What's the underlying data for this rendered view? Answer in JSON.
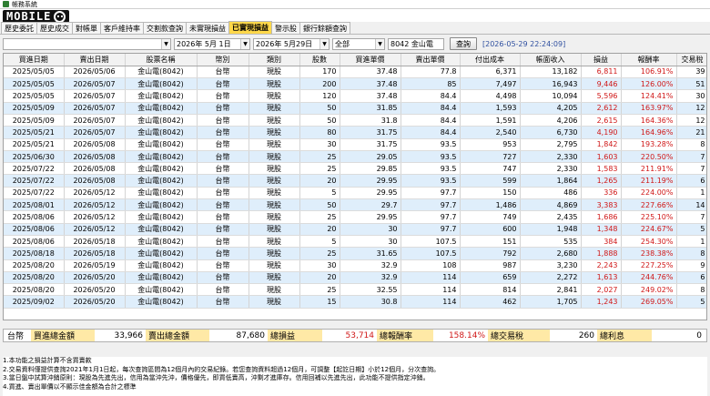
{
  "window": {
    "title": "帳務系統"
  },
  "logo": {
    "text": "MOBILE"
  },
  "tabs": [
    {
      "label": "歷史委託",
      "active": false
    },
    {
      "label": "歷史成交",
      "active": false
    },
    {
      "label": "對帳單",
      "active": false
    },
    {
      "label": "客戶維持率",
      "active": false
    },
    {
      "label": "交割款查詢",
      "active": false
    },
    {
      "label": "未實現損益",
      "active": false
    },
    {
      "label": "已實現損益",
      "active": true
    },
    {
      "label": "警示股",
      "active": false
    },
    {
      "label": "銀行餘額查詢",
      "active": false
    }
  ],
  "toolbar": {
    "account_value": "",
    "start_date": "2026年 5月 1日",
    "end_date": "2026年 5月29日",
    "market_filter": "全部",
    "stock_filter": "8042 金山電",
    "query_label": "查詢",
    "timestamp": "[2026-05-29 22:24:09]"
  },
  "table": {
    "columns": [
      "買進日期",
      "賣出日期",
      "股票名稱",
      "幣別",
      "類別",
      "股數",
      "買進單價",
      "賣出單價",
      "付出成本",
      "帳面收入",
      "損益",
      "報酬率",
      "交易稅"
    ],
    "rows": [
      [
        "2025/05/05",
        "2026/05/06",
        "金山電(8042)",
        "台幣",
        "現股",
        "170",
        "37.48",
        "77.8",
        "6,371",
        "13,182",
        "6,811",
        "106.91%",
        "39"
      ],
      [
        "2025/05/05",
        "2026/05/07",
        "金山電(8042)",
        "台幣",
        "現股",
        "200",
        "37.48",
        "85",
        "7,497",
        "16,943",
        "9,446",
        "126.00%",
        "51"
      ],
      [
        "2025/05/05",
        "2026/05/07",
        "金山電(8042)",
        "台幣",
        "現股",
        "120",
        "37.48",
        "84.4",
        "4,498",
        "10,094",
        "5,596",
        "124.41%",
        "30"
      ],
      [
        "2025/05/09",
        "2026/05/07",
        "金山電(8042)",
        "台幣",
        "現股",
        "50",
        "31.85",
        "84.4",
        "1,593",
        "4,205",
        "2,612",
        "163.97%",
        "12"
      ],
      [
        "2025/05/09",
        "2026/05/07",
        "金山電(8042)",
        "台幣",
        "現股",
        "50",
        "31.8",
        "84.4",
        "1,591",
        "4,206",
        "2,615",
        "164.36%",
        "12"
      ],
      [
        "2025/05/21",
        "2026/05/07",
        "金山電(8042)",
        "台幣",
        "現股",
        "80",
        "31.75",
        "84.4",
        "2,540",
        "6,730",
        "4,190",
        "164.96%",
        "21"
      ],
      [
        "2025/05/21",
        "2026/05/08",
        "金山電(8042)",
        "台幣",
        "現股",
        "30",
        "31.75",
        "93.5",
        "953",
        "2,795",
        "1,842",
        "193.28%",
        "8"
      ],
      [
        "2025/06/30",
        "2026/05/08",
        "金山電(8042)",
        "台幣",
        "現股",
        "25",
        "29.05",
        "93.5",
        "727",
        "2,330",
        "1,603",
        "220.50%",
        "7"
      ],
      [
        "2025/07/22",
        "2026/05/08",
        "金山電(8042)",
        "台幣",
        "現股",
        "25",
        "29.85",
        "93.5",
        "747",
        "2,330",
        "1,583",
        "211.91%",
        "7"
      ],
      [
        "2025/07/22",
        "2026/05/08",
        "金山電(8042)",
        "台幣",
        "現股",
        "20",
        "29.95",
        "93.5",
        "599",
        "1,864",
        "1,265",
        "211.19%",
        "6"
      ],
      [
        "2025/07/22",
        "2026/05/12",
        "金山電(8042)",
        "台幣",
        "現股",
        "5",
        "29.95",
        "97.7",
        "150",
        "486",
        "336",
        "224.00%",
        "1"
      ],
      [
        "2025/08/01",
        "2026/05/12",
        "金山電(8042)",
        "台幣",
        "現股",
        "50",
        "29.7",
        "97.7",
        "1,486",
        "4,869",
        "3,383",
        "227.66%",
        "14"
      ],
      [
        "2025/08/06",
        "2026/05/12",
        "金山電(8042)",
        "台幣",
        "現股",
        "25",
        "29.95",
        "97.7",
        "749",
        "2,435",
        "1,686",
        "225.10%",
        "7"
      ],
      [
        "2025/08/06",
        "2026/05/12",
        "金山電(8042)",
        "台幣",
        "現股",
        "20",
        "30",
        "97.7",
        "600",
        "1,948",
        "1,348",
        "224.67%",
        "5"
      ],
      [
        "2025/08/06",
        "2026/05/18",
        "金山電(8042)",
        "台幣",
        "現股",
        "5",
        "30",
        "107.5",
        "151",
        "535",
        "384",
        "254.30%",
        "1"
      ],
      [
        "2025/08/18",
        "2026/05/18",
        "金山電(8042)",
        "台幣",
        "現股",
        "25",
        "31.65",
        "107.5",
        "792",
        "2,680",
        "1,888",
        "238.38%",
        "8"
      ],
      [
        "2025/08/20",
        "2026/05/19",
        "金山電(8042)",
        "台幣",
        "現股",
        "30",
        "32.9",
        "108",
        "987",
        "3,230",
        "2,243",
        "227.25%",
        "9"
      ],
      [
        "2025/08/20",
        "2026/05/20",
        "金山電(8042)",
        "台幣",
        "現股",
        "20",
        "32.9",
        "114",
        "659",
        "2,272",
        "1,613",
        "244.76%",
        "6"
      ],
      [
        "2025/08/20",
        "2026/05/20",
        "金山電(8042)",
        "台幣",
        "現股",
        "25",
        "32.55",
        "114",
        "814",
        "2,841",
        "2,027",
        "249.02%",
        "8"
      ],
      [
        "2025/09/02",
        "2026/05/20",
        "金山電(8042)",
        "台幣",
        "現股",
        "15",
        "30.8",
        "114",
        "462",
        "1,705",
        "1,243",
        "269.05%",
        "5"
      ]
    ]
  },
  "summary": {
    "currency": "台幣",
    "buy_total_label": "買進總金額",
    "buy_total": "33,966",
    "sell_total_label": "賣出總金額",
    "sell_total": "87,680",
    "pnl_label": "總損益",
    "pnl": "53,714",
    "return_label": "總報酬率",
    "return": "158.14%",
    "tax_label": "總交易稅",
    "tax": "260",
    "interest_label": "總利息",
    "interest": "0"
  },
  "notes": [
    "1.本功能之損益計算不含買賣款",
    "2.交易資料僅提供查詢2021年1月1日起，每次查詢區間為12個月內的交易紀錄。若您查詢資料超過12個月，可調整【起訖日期】小於12個月，分次查詢。",
    "3.當日盤中試算沖銷原則：現股為先進先出，信用為當沖先沖，價格優先，即買低賣高，沖剩才進庫存。信用回補以先進先出，此功能不提供指定沖銷。",
    "4.買進、賣出單價以不顯示佳金額為合計之標準"
  ],
  "colors": {
    "active_tab": "#ffd84a",
    "row_alt": "#dfeefb",
    "profit": "#d01818",
    "timestamp": "#3050a0"
  }
}
